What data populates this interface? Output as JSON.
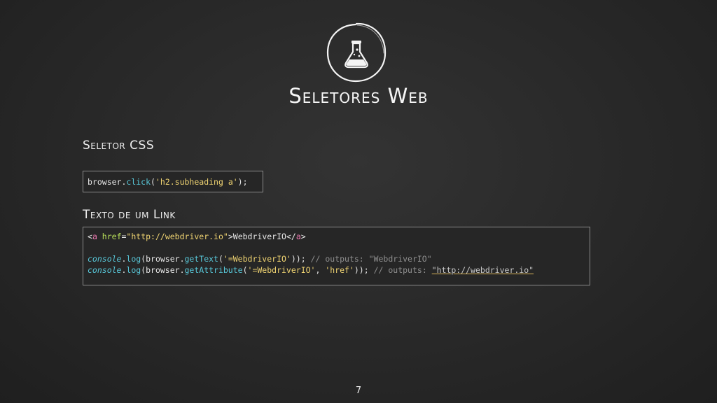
{
  "slide": {
    "title": "Seletores Web",
    "logo_icon": "flask-icon",
    "page_number": "7"
  },
  "sections": [
    {
      "label": "Seletor CSS",
      "code": {
        "obj": "browser",
        "dot": ".",
        "method": "click",
        "open": "(",
        "arg": "'h2.subheading a'",
        "close": ");"
      }
    },
    {
      "label": "Texto de um Link",
      "code": {
        "line1": {
          "lt": "<",
          "tag": "a",
          "attr": " href",
          "eq": "=",
          "value": "\"http://webdriver.io\"",
          "gt": ">",
          "text": "WebdriverIO",
          "close_lt": "</",
          "close_tag": "a",
          "close_gt": ">"
        },
        "line2": {
          "obj": "console",
          "dot1": ".",
          "method": "log",
          "open": "(browser.",
          "inner_method": "getText",
          "inner_open": "(",
          "arg": "'=WebdriverIO'",
          "close": "));",
          "comment": " // outputs: \"WebdriverIO\""
        },
        "line3": {
          "obj": "console",
          "dot1": ".",
          "method": "log",
          "open": "(browser.",
          "inner_method": "getAttribute",
          "inner_open": "(",
          "arg1": "'=WebdriverIO'",
          "sep": ", ",
          "arg2": "'href'",
          "close": "));",
          "comment": " // outputs: ",
          "url": "\"http://webdriver.io\""
        }
      }
    }
  ],
  "colors": {
    "background": "#2a2a2a",
    "code_function": "#58c7d8",
    "code_string": "#f0d472",
    "code_tag": "#f07bb3",
    "code_attribute": "#b8e05a",
    "code_comment": "#8f8f8f"
  }
}
